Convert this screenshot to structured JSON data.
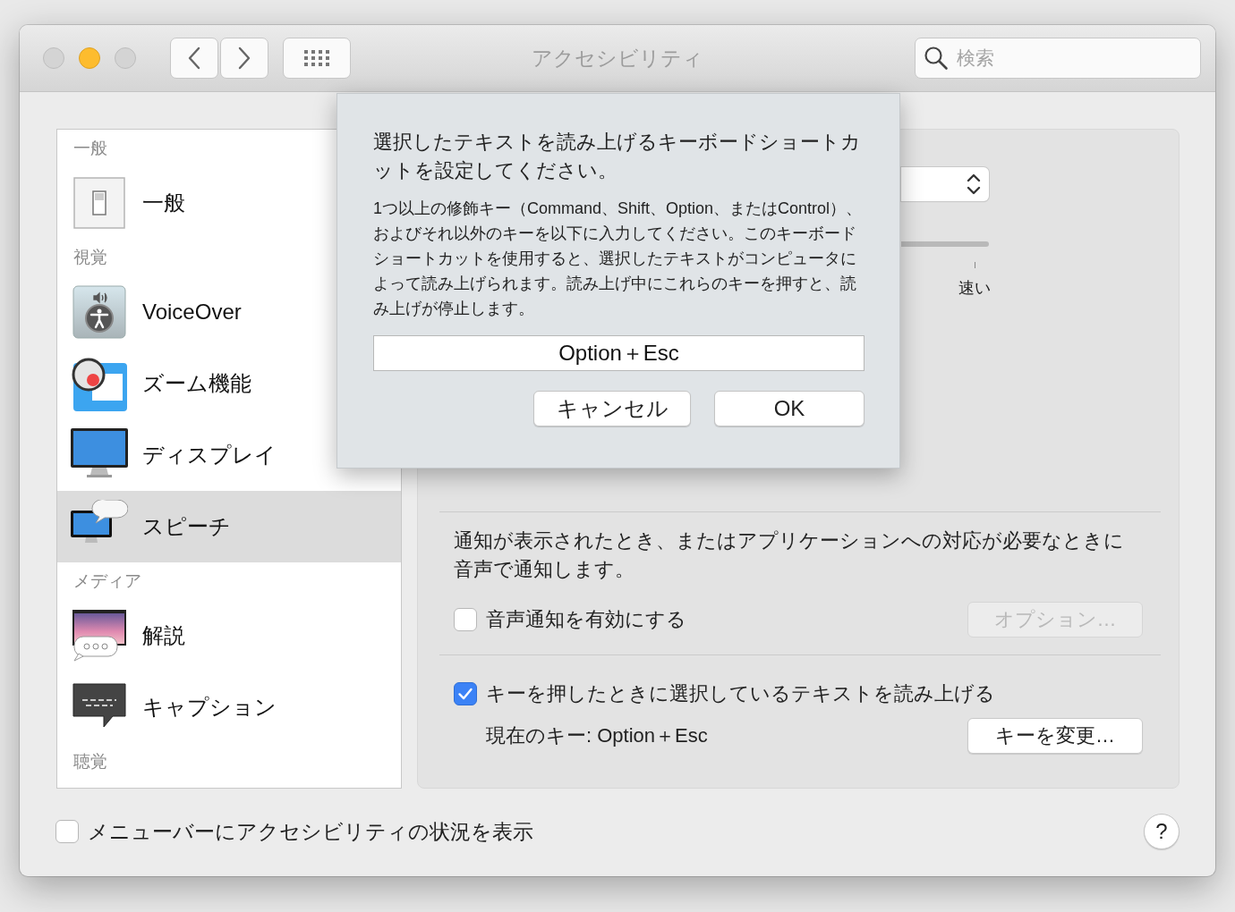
{
  "window": {
    "title": "アクセシビリティ"
  },
  "search": {
    "placeholder": "検索"
  },
  "sidebar": {
    "sections": [
      {
        "title": "一般",
        "items": [
          {
            "label": "一般",
            "kind": "switch",
            "selected": false
          }
        ]
      },
      {
        "title": "視覚",
        "items": [
          {
            "label": "VoiceOver",
            "kind": "voiceover",
            "selected": false
          },
          {
            "label": "ズーム機能",
            "kind": "zoom",
            "selected": false
          },
          {
            "label": "ディスプレイ",
            "kind": "display",
            "selected": false
          },
          {
            "label": "スピーチ",
            "kind": "speech",
            "selected": true
          }
        ]
      },
      {
        "title": "メディア",
        "items": [
          {
            "label": "解説",
            "kind": "description",
            "selected": false
          },
          {
            "label": "キャプション",
            "kind": "captions",
            "selected": false
          }
        ]
      },
      {
        "title": "聴覚"
      }
    ]
  },
  "speech": {
    "rate_max_label": "速い",
    "announcements": {
      "description": "通知が表示されたとき、またはアプリケーションへの対応が必要なときに音声で通知します。",
      "checkbox": {
        "label": "音声通知を有効にする",
        "checked": false
      },
      "options_button": {
        "label": "オプション…",
        "disabled": true
      }
    },
    "speak_selection": {
      "checkbox": {
        "label": "キーを押したときに選択しているテキストを読み上げる",
        "checked": true
      },
      "current_key": "現在のキー: Option＋Esc",
      "change_button": {
        "label": "キーを変更…",
        "disabled": false
      }
    }
  },
  "footer": {
    "checkbox": {
      "label": "メニューバーにアクセシビリティの状況を表示",
      "checked": false
    },
    "help_label": "?"
  },
  "dialog": {
    "title": "選択したテキストを読み上げるキーボードショートカットを設定してください。",
    "message": "1つ以上の修飾キー（Command、Shift、Option、またはControl）、およびそれ以外のキーを以下に入力してください。このキーボードショートカットを使用すると、選択したテキストがコンピュータによって読み上げられます。読み上げ中にこれらのキーを押すと、読み上げが停止します。",
    "shortcut_value": "Option＋Esc",
    "buttons": [
      {
        "label": "キャンセル",
        "kind": "cancel"
      },
      {
        "label": "OK",
        "kind": "ok"
      }
    ]
  }
}
